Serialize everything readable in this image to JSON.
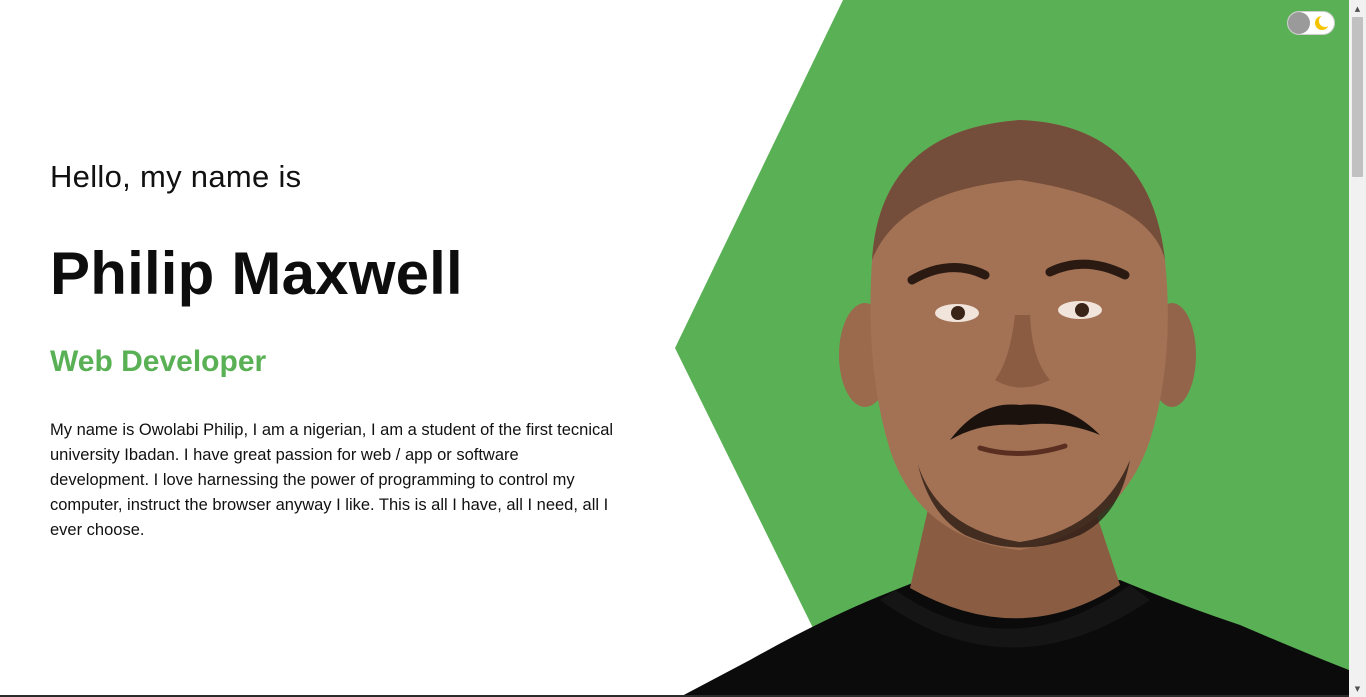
{
  "colors": {
    "accent": "#5ab155",
    "text": "#111111",
    "background": "#ffffff"
  },
  "intro": {
    "greeting": "Hello, my name is",
    "name": "Philip Maxwell",
    "role": "Web Developer",
    "bio": "My name is Owolabi Philip, I am a nigerian, I am a student of the first tecnical university Ibadan. I have great passion for web / app or software development. I love harnessing the power of programming to control my computer, instruct the browser anyway I like. This is all I have, all I need, all I ever choose."
  },
  "theme_toggle": {
    "icon": "moon-icon",
    "state": "light"
  },
  "portrait": {
    "subject": "portrait-photo"
  }
}
